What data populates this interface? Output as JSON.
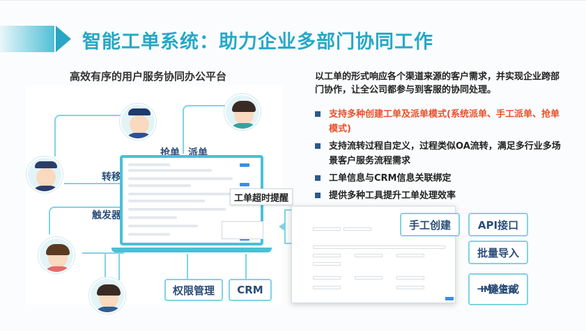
{
  "slide": {
    "title": "智能工单系统：助力企业多部门协同工作",
    "left_heading": "高效有序的用户服务协同办公平台",
    "description": "以工单的形式响应各个渠道来源的客户需求，并实现企业跨部门协作，让全公司都参与到客服的协同处理。",
    "bullets": [
      {
        "text": "支持多种创建工单及派单模式(系统派单、手工派单、抢单模式)",
        "highlight": true
      },
      {
        "text": "支持流转过程自定义，过程类似OA流转，满足多行业多场景客户服务流程需求",
        "highlight": false
      },
      {
        "text": "工单信息与CRM信息关联绑定",
        "highlight": false
      },
      {
        "text": "提供多种工具提升工单处理效率",
        "highlight": false
      }
    ],
    "diagram_labels": {
      "grab": "抢单",
      "dispatch": "派单",
      "transfer": "转移",
      "trigger": "触发器",
      "timeout_alert": "工单超时提醒",
      "permission": "权限管理",
      "crm": "CRM"
    },
    "tools": {
      "manual_create": "手工创建",
      "api": "API接口",
      "batch_import": "批量导入",
      "one_click_line1": "一键生成",
      "one_click_line2": "IM&语音"
    },
    "colors": {
      "title": "#25a8c7",
      "accent_line": "#7fd3e3",
      "highlight_text": "#e8502a",
      "bullet_square": "#2b5a8c",
      "label_text": "#2b4d78"
    }
  }
}
